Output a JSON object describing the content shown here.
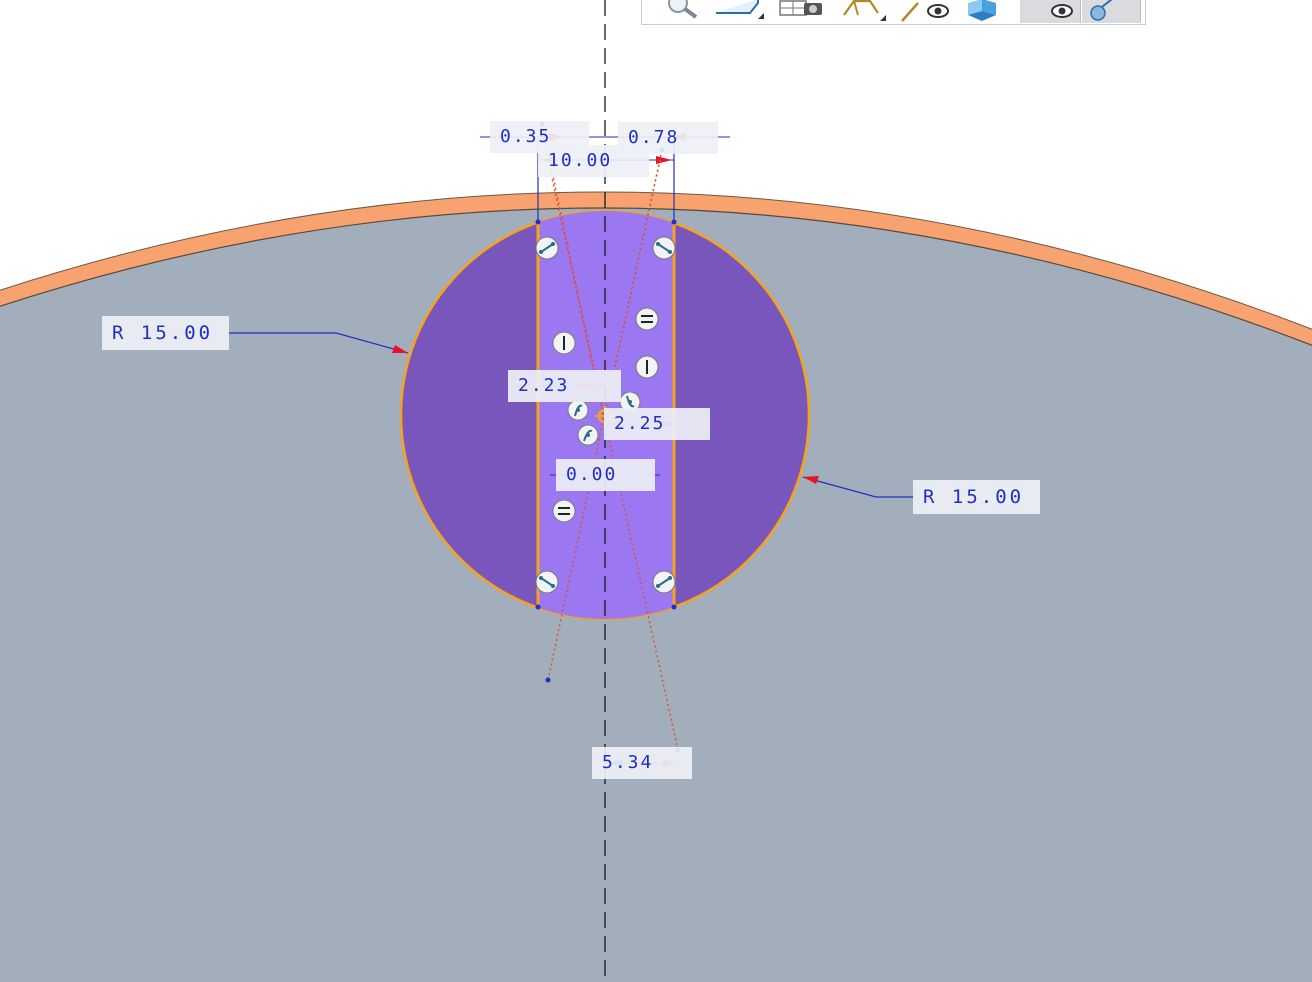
{
  "toolbar": {
    "buttons": [
      {
        "name": "zoom-icon"
      },
      {
        "name": "display-style-icon"
      },
      {
        "name": "saved-views-icon"
      },
      {
        "name": "sketch-display-icon"
      },
      {
        "name": "annotation-display-icon"
      },
      {
        "name": "view-manager-icon"
      },
      {
        "name": "visibility-toggle-icon"
      },
      {
        "name": "appearance-toggle-icon"
      }
    ]
  },
  "dimensions": {
    "radius_left": "R 15.00",
    "radius_right": "R 15.00",
    "top_left": "0.35",
    "top_right": "0.78",
    "width": "10.00",
    "offset_left": "2.23",
    "offset_right": "2.25",
    "center": "0.00",
    "bottom": "5.34"
  },
  "colors": {
    "background": "#ffffff",
    "part_face": "#a2aebb",
    "part_edge": "#f7a26f",
    "sketch_circle": "#7856bb",
    "sketch_band": "#9b78f2",
    "highlight_edge": "#f7a21b",
    "dimension": "#1f2fbf",
    "arrow": "#e8102a",
    "constraint_line": "#e24a2a"
  }
}
